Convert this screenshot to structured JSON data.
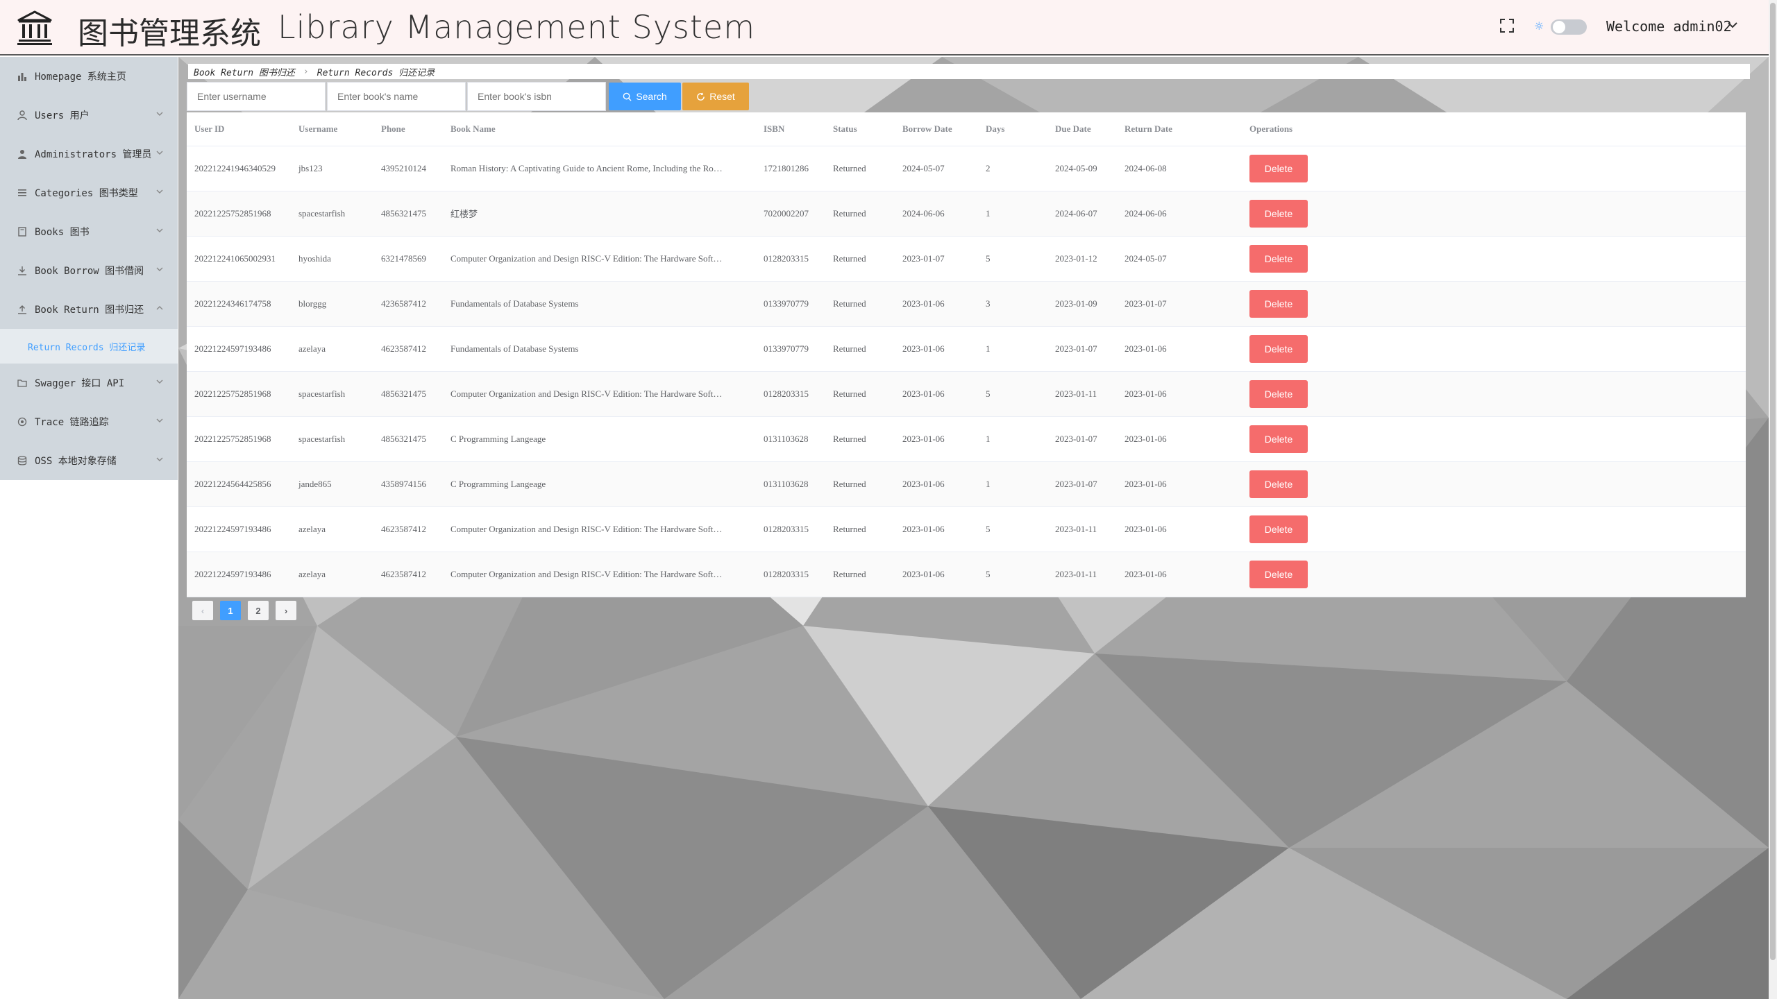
{
  "header": {
    "title_zh": "图书管理系统",
    "title_en": "Library Management System",
    "welcome": "Welcome admin02",
    "logo_icon": "library-building-icon",
    "fullscreen_icon": "fullscreen-icon",
    "theme_icon": "sun-icon"
  },
  "sidebar": {
    "items": [
      {
        "label": "Homepage 系统主页",
        "icon": "bar-chart-icon"
      },
      {
        "label": "Users 用户",
        "icon": "user-icon"
      },
      {
        "label": "Administrators 管理员",
        "icon": "admin-icon"
      },
      {
        "label": "Categories 图书类型",
        "icon": "list-icon"
      },
      {
        "label": "Books 图书",
        "icon": "book-icon"
      },
      {
        "label": "Book Borrow 图书借阅",
        "icon": "download-icon"
      },
      {
        "label": "Book Return 图书归还",
        "icon": "upload-icon"
      },
      {
        "label": "Swagger 接口 API",
        "icon": "folder-icon"
      },
      {
        "label": "Trace 链路追踪",
        "icon": "trace-icon"
      },
      {
        "label": "OSS 本地对象存储",
        "icon": "database-icon"
      }
    ],
    "sub_item": "Return Records 归还记录"
  },
  "breadcrumb": {
    "level1": "Book Return 图书归还",
    "level2": "Return Records 归还记录"
  },
  "search": {
    "username_placeholder": "Enter username",
    "bookname_placeholder": "Enter book's name",
    "isbn_placeholder": "Enter book's isbn",
    "search_label": "Search",
    "reset_label": "Reset"
  },
  "table": {
    "headers": {
      "user_id": "User ID",
      "username": "Username",
      "phone": "Phone",
      "book_name": "Book Name",
      "isbn": "ISBN",
      "status": "Status",
      "borrow_date": "Borrow Date",
      "days": "Days",
      "due_date": "Due Date",
      "return_date": "Return Date",
      "operations": "Operations"
    },
    "delete_label": "Delete",
    "rows": [
      {
        "user_id": "202212241946340529",
        "username": "jbs123",
        "phone": "4395210124",
        "book_name": "Roman History: A Captivating Guide to Ancient Rome, Including the Ro…",
        "isbn": "1721801286",
        "status": "Returned",
        "borrow_date": "2024-05-07",
        "days": "2",
        "due_date": "2024-05-09",
        "return_date": "2024-06-08"
      },
      {
        "user_id": "20221225752851968",
        "username": "spacestarfish",
        "phone": "4856321475",
        "book_name": "红楼梦",
        "isbn": "7020002207",
        "status": "Returned",
        "borrow_date": "2024-06-06",
        "days": "1",
        "due_date": "2024-06-07",
        "return_date": "2024-06-06"
      },
      {
        "user_id": "202212241065002931",
        "username": "hyoshida",
        "phone": "6321478569",
        "book_name": "Computer Organization and Design RISC-V Edition: The Hardware Soft…",
        "isbn": "0128203315",
        "status": "Returned",
        "borrow_date": "2023-01-07",
        "days": "5",
        "due_date": "2023-01-12",
        "return_date": "2024-05-07"
      },
      {
        "user_id": "20221224346174758",
        "username": "blorggg",
        "phone": "4236587412",
        "book_name": "Fundamentals of Database Systems",
        "isbn": "0133970779",
        "status": "Returned",
        "borrow_date": "2023-01-06",
        "days": "3",
        "due_date": "2023-01-09",
        "return_date": "2023-01-07"
      },
      {
        "user_id": "20221224597193486",
        "username": "azelaya",
        "phone": "4623587412",
        "book_name": "Fundamentals of Database Systems",
        "isbn": "0133970779",
        "status": "Returned",
        "borrow_date": "2023-01-06",
        "days": "1",
        "due_date": "2023-01-07",
        "return_date": "2023-01-06"
      },
      {
        "user_id": "20221225752851968",
        "username": "spacestarfish",
        "phone": "4856321475",
        "book_name": "Computer Organization and Design RISC-V Edition: The Hardware Soft…",
        "isbn": "0128203315",
        "status": "Returned",
        "borrow_date": "2023-01-06",
        "days": "5",
        "due_date": "2023-01-11",
        "return_date": "2023-01-06"
      },
      {
        "user_id": "20221225752851968",
        "username": "spacestarfish",
        "phone": "4856321475",
        "book_name": "C Programming Langeage",
        "isbn": "0131103628",
        "status": "Returned",
        "borrow_date": "2023-01-06",
        "days": "1",
        "due_date": "2023-01-07",
        "return_date": "2023-01-06"
      },
      {
        "user_id": "20221224564425856",
        "username": "jande865",
        "phone": "4358974156",
        "book_name": "C Programming Langeage",
        "isbn": "0131103628",
        "status": "Returned",
        "borrow_date": "2023-01-06",
        "days": "1",
        "due_date": "2023-01-07",
        "return_date": "2023-01-06"
      },
      {
        "user_id": "20221224597193486",
        "username": "azelaya",
        "phone": "4623587412",
        "book_name": "Computer Organization and Design RISC-V Edition: The Hardware Soft…",
        "isbn": "0128203315",
        "status": "Returned",
        "borrow_date": "2023-01-06",
        "days": "5",
        "due_date": "2023-01-11",
        "return_date": "2023-01-06"
      },
      {
        "user_id": "20221224597193486",
        "username": "azelaya",
        "phone": "4623587412",
        "book_name": "Computer Organization and Design RISC-V Edition: The Hardware Soft…",
        "isbn": "0128203315",
        "status": "Returned",
        "borrow_date": "2023-01-06",
        "days": "5",
        "due_date": "2023-01-11",
        "return_date": "2023-01-06"
      }
    ]
  },
  "pagination": {
    "prev_icon": "chevron-left-icon",
    "pages": [
      "1",
      "2"
    ],
    "current": "1",
    "next_icon": "chevron-right-icon"
  },
  "colors": {
    "primary": "#409eff",
    "warning": "#e6a23c",
    "danger": "#f56c6c",
    "header_bg": "#fdf3f3",
    "menu_bg": "#d0d7dd"
  }
}
